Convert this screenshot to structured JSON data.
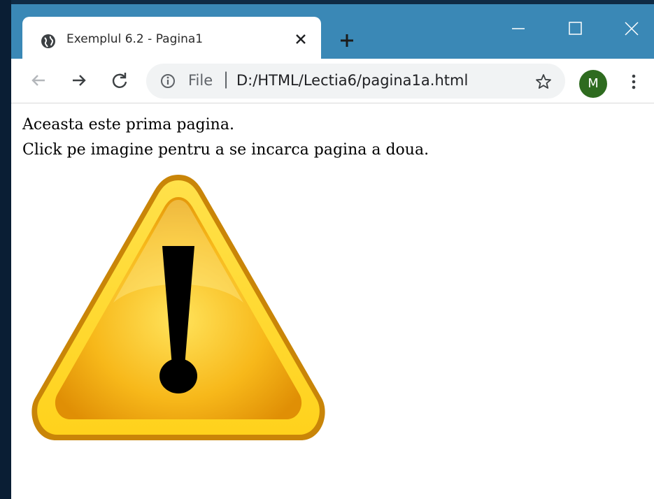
{
  "browser": {
    "tab": {
      "title": "Exemplul 6.2 - Pagina1",
      "favicon_icon": "globe-icon",
      "close_icon": "close-icon"
    },
    "new_tab_icon": "plus-icon",
    "window_controls": [
      "minimize-icon",
      "maximize-icon",
      "close-icon"
    ],
    "toolbar": {
      "back_icon": "arrow-left-icon",
      "forward_icon": "arrow-right-icon",
      "reload_icon": "reload-icon",
      "info_icon": "info-icon",
      "scheme": "File",
      "separator": "|",
      "url": "D:/HTML/Lectia6/pagina1a.html",
      "bookmark_icon": "star-icon",
      "profile_initial": "M",
      "menu_icon": "kebab-menu-icon"
    },
    "colors": {
      "titlebar": "#3a88b6",
      "avatar": "#2e6b1f"
    }
  },
  "page": {
    "line1": "Aceasta este prima pagina.",
    "line2": "Click pe imagine pentru a se incarca pagina a doua.",
    "image_icon": "warning-icon"
  }
}
